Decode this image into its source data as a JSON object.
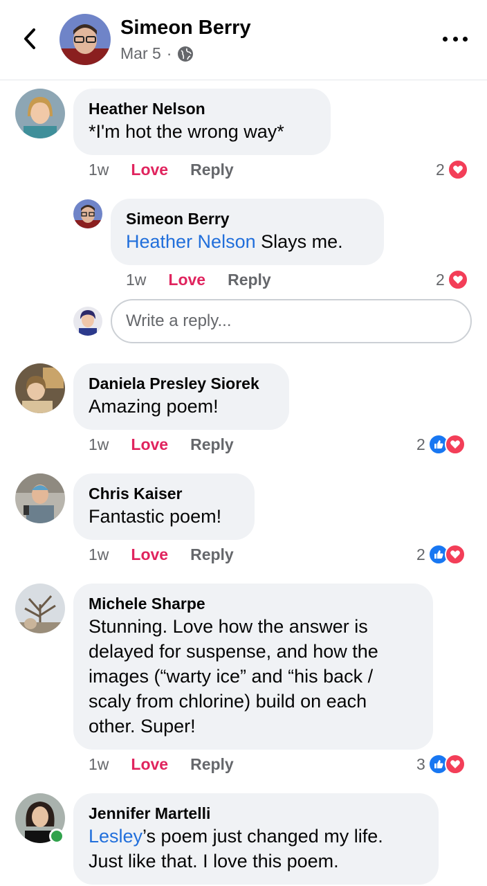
{
  "header": {
    "name": "Simeon Berry",
    "date": "Mar 5",
    "separator": "·"
  },
  "comments": [
    {
      "name": "Heather Nelson",
      "text": "*I'm hot the wrong way*",
      "time": "1w",
      "love": "Love",
      "reply": "Reply",
      "reaction_count": "2"
    },
    {
      "name": "Simeon Berry",
      "mention": "Heather Nelson",
      "text": " Slays me.",
      "time": "1w",
      "love": "Love",
      "reply": "Reply",
      "reaction_count": "2"
    },
    {
      "name": "Daniela Presley Siorek",
      "text": "Amazing poem!",
      "time": "1w",
      "love": "Love",
      "reply": "Reply",
      "reaction_count": "2"
    },
    {
      "name": "Chris Kaiser",
      "text": "Fantastic poem!",
      "time": "1w",
      "love": "Love",
      "reply": "Reply",
      "reaction_count": "2"
    },
    {
      "name": "Michele Sharpe",
      "text_lines": [
        "Stunning. Love how the answer is",
        "delayed for suspense, and how the",
        "images (“warty ice” and “his back /",
        "scaly from chlorine) build on each",
        "other. Super!"
      ],
      "time": "1w",
      "love": "Love",
      "reply": "Reply",
      "reaction_count": "3"
    },
    {
      "name": "Jennifer Martelli",
      "mention": "Lesley",
      "text_line1": "’s poem just changed my life.",
      "text_line2": "Just like that. I love this poem."
    }
  ],
  "reply_input": {
    "placeholder": "Write a reply..."
  },
  "colors": {
    "love": "#e0245e",
    "mention": "#216fdb",
    "like": "#1877f2",
    "heart": "#f33e58",
    "bubble": "#f0f2f5",
    "online": "#31a24c"
  }
}
